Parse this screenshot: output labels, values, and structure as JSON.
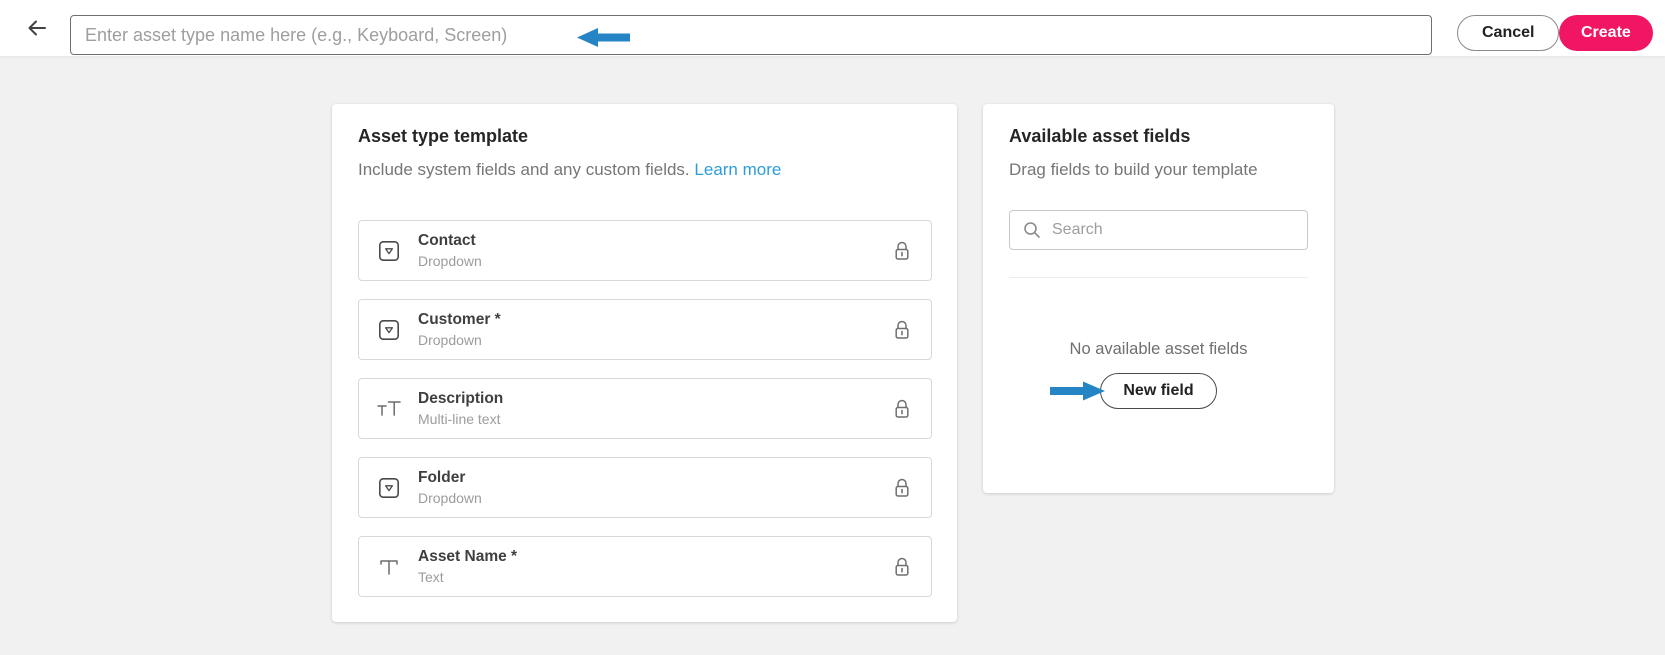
{
  "topbar": {
    "name_input": {
      "value": "",
      "placeholder": "Enter asset type name here (e.g., Keyboard, Screen)"
    },
    "cancel_label": "Cancel",
    "create_label": "Create"
  },
  "template_card": {
    "title": "Asset type template",
    "subtitle": "Include system fields and any custom fields.",
    "learn_more_label": "Learn more",
    "fields": [
      {
        "name": "Contact",
        "type": "Dropdown",
        "icon": "dropdown-icon",
        "locked": true
      },
      {
        "name": "Customer *",
        "type": "Dropdown",
        "icon": "dropdown-icon",
        "locked": true
      },
      {
        "name": "Description",
        "type": "Multi-line text",
        "icon": "multiline-text-icon",
        "locked": true
      },
      {
        "name": "Folder",
        "type": "Dropdown",
        "icon": "dropdown-icon",
        "locked": true
      },
      {
        "name": "Asset Name *",
        "type": "Text",
        "icon": "text-icon",
        "locked": true
      }
    ]
  },
  "available_card": {
    "title": "Available asset fields",
    "subtitle": "Drag fields to build your template",
    "search": {
      "value": "",
      "placeholder": "Search"
    },
    "empty_message": "No available asset fields",
    "new_field_label": "New field"
  },
  "annotations": {
    "input_arrow_direction": "left",
    "new_field_arrow_direction": "right",
    "arrow_color": "#2484c4"
  },
  "colors": {
    "create_button": "#f01663",
    "link": "#2d9cdb",
    "page_background": "#f1f1f2",
    "card_background": "#ffffff"
  }
}
